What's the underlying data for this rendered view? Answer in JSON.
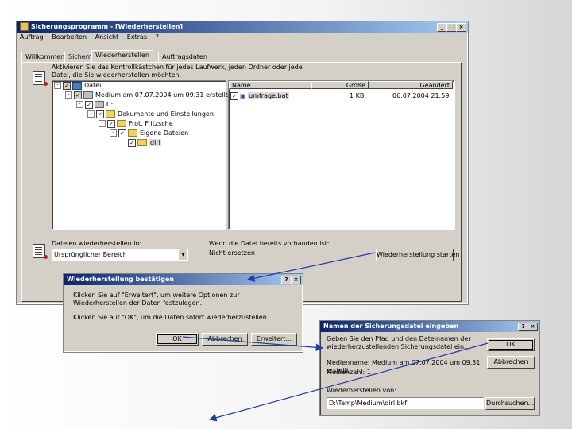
{
  "main": {
    "title": "Sicherungsprogramm - [Wiederherstellen]",
    "menu": [
      "Auftrag",
      "Bearbeiten",
      "Ansicht",
      "Extras",
      "?"
    ],
    "tabs": [
      "Willkommen",
      "Sichern",
      "Wiederherstellen",
      "Auftragsdaten"
    ],
    "instruction": "Aktivieren Sie das Kontrollkästchen für jedes Laufwerk, jeden Ordner oder jede Datei, die Sie wiederherstellen möchten.",
    "tree": [
      {
        "label": "Datei",
        "level": 0,
        "icon": "desktop-icon",
        "check": "partial",
        "expander": "-"
      },
      {
        "label": "Medium am 07.07.2004 um 09.31 erstellt",
        "level": 1,
        "icon": "media-icon",
        "check": "partial",
        "expander": "-"
      },
      {
        "label": "C:",
        "level": 2,
        "icon": "drive-icon",
        "check": "checked",
        "expander": "-"
      },
      {
        "label": "Dokumente und Einstellungen",
        "level": 3,
        "icon": "folder-icon",
        "check": "checked",
        "expander": "-"
      },
      {
        "label": "Frot. Fritzsche",
        "level": 4,
        "icon": "folder-icon",
        "check": "checked",
        "expander": "-"
      },
      {
        "label": "Eigene Dateien",
        "level": 5,
        "icon": "folder-icon",
        "check": "checked",
        "expander": "-"
      },
      {
        "label": "dirl",
        "level": 6,
        "icon": "folder-icon",
        "check": "checked",
        "expander": "",
        "selected": true
      }
    ],
    "list_headers": [
      "Name",
      "Größe",
      "Geändert"
    ],
    "list_rows": [
      {
        "name": "umfrage.bat",
        "size": "1 KB",
        "modified": "06.07.2004 21:59"
      }
    ],
    "restore_to_label": "Dateien wiederherstellen in:",
    "restore_to_value": "Ursprünglicher Bereich",
    "exists_label": "Wenn die Datei bereits vorhanden ist:",
    "exists_value": "Nicht ersetzen",
    "start_button": "Wiederherstellung starten"
  },
  "confirm": {
    "title": "Wiederherstellung bestätigen",
    "line1": "Klicken Sie auf \"Erweitert\", um weitere Optionen zur Wiederherstellen der Daten festzulegen.",
    "line2": "Klicken Sie auf \"OK\", um die Daten sofort wiederherzustellen.",
    "ok": "OK",
    "cancel": "Abbrechen",
    "advanced": "Erweitert..."
  },
  "backupname": {
    "title": "Namen der Sicherungsdatei eingeben",
    "prompt": "Geben Sie den Pfad und den Dateinamen der wiederherzustellenden Sicherungsdatei ein.",
    "media_info": "Medienname: Medium am 07.07.2004 um 09.31 erstellt.",
    "media_count": "Medienzahl: 1",
    "restore_from_label": "Wiederherstellen von:",
    "restore_from_value": "D:\\Temp\\Medium\\dirl.bkf",
    "ok": "OK",
    "cancel": "Abbrechen",
    "browse": "Durchsuchen..."
  },
  "colors": {
    "titlebar": "#0a246a",
    "face": "#d4d0c8",
    "arrow": "#1f3fa8"
  }
}
